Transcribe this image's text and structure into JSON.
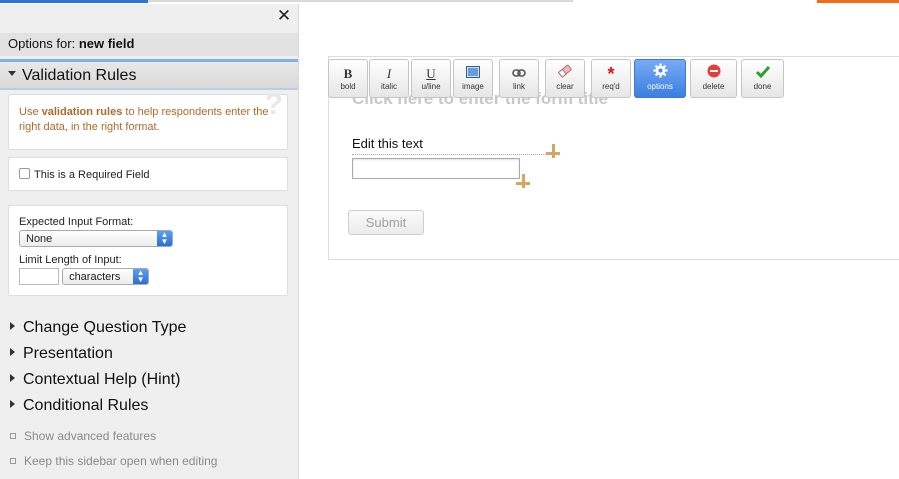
{
  "sidebar": {
    "options_for_label": "Options for:",
    "field_name": "new field",
    "validation_header": "Validation Rules",
    "help": {
      "prefix": "Use ",
      "bold": "validation rules",
      "suffix": " to help respondents enter the right data, in the right format.",
      "icon": "question-mark-icon"
    },
    "required_label": "This is a Required Field",
    "expected_format_label": "Expected Input Format:",
    "expected_format_value": "None",
    "limit_length_label": "Limit Length of Input:",
    "limit_unit_value": "characters",
    "sections": [
      "Change Question Type",
      "Presentation",
      "Contextual Help (Hint)",
      "Conditional Rules"
    ],
    "show_advanced": "Show advanced features",
    "keep_open": "Keep this sidebar open when editing"
  },
  "toolbar": {
    "buttons": [
      {
        "icon": "B",
        "label": "bold"
      },
      {
        "icon": "I",
        "label": "italic"
      },
      {
        "icon": "U",
        "label": "u/line"
      },
      {
        "icon": "image-icon",
        "label": "image"
      },
      {
        "icon": "link-icon",
        "label": "link"
      },
      {
        "icon": "eraser-icon",
        "label": "clear"
      },
      {
        "icon": "*",
        "label": "req'd"
      },
      {
        "icon": "gear-icon",
        "label": "options"
      },
      {
        "icon": "minus-circle-icon",
        "label": "delete"
      },
      {
        "icon": "check-icon",
        "label": "done"
      }
    ],
    "active": "options"
  },
  "form": {
    "title_placeholder": "Click here to enter the form title",
    "field_label": "Edit this text",
    "submit_label": "Submit"
  },
  "colors": {
    "accent_blue": "#3c7fe0",
    "help_text": "#b06a2c",
    "required_star": "#e01010",
    "delete_red": "#e04040",
    "done_green": "#2aa02a",
    "top_orange": "#f26a1b"
  }
}
